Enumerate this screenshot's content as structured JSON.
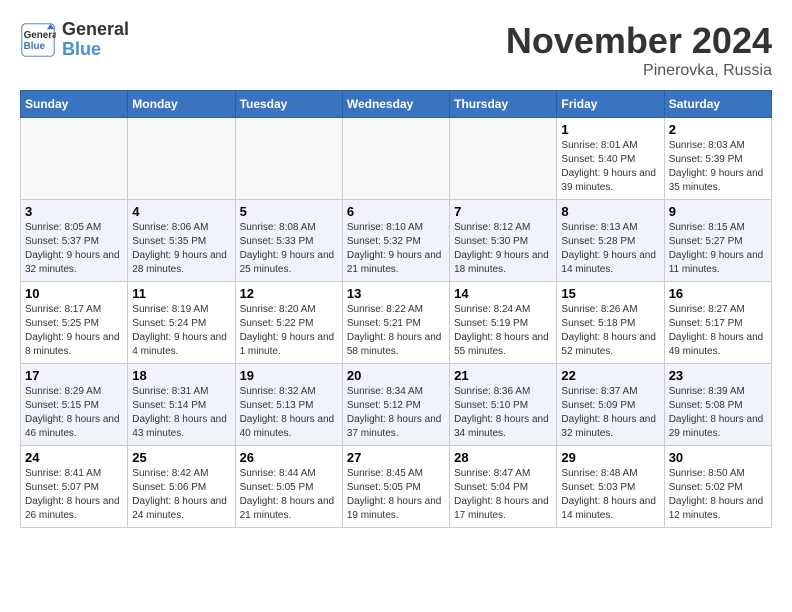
{
  "logo": {
    "line1": "General",
    "line2": "Blue"
  },
  "title": "November 2024",
  "location": "Pinerovka, Russia",
  "days_of_week": [
    "Sunday",
    "Monday",
    "Tuesday",
    "Wednesday",
    "Thursday",
    "Friday",
    "Saturday"
  ],
  "weeks": [
    [
      {
        "day": "",
        "info": ""
      },
      {
        "day": "",
        "info": ""
      },
      {
        "day": "",
        "info": ""
      },
      {
        "day": "",
        "info": ""
      },
      {
        "day": "",
        "info": ""
      },
      {
        "day": "1",
        "info": "Sunrise: 8:01 AM\nSunset: 5:40 PM\nDaylight: 9 hours and 39 minutes."
      },
      {
        "day": "2",
        "info": "Sunrise: 8:03 AM\nSunset: 5:39 PM\nDaylight: 9 hours and 35 minutes."
      }
    ],
    [
      {
        "day": "3",
        "info": "Sunrise: 8:05 AM\nSunset: 5:37 PM\nDaylight: 9 hours and 32 minutes."
      },
      {
        "day": "4",
        "info": "Sunrise: 8:06 AM\nSunset: 5:35 PM\nDaylight: 9 hours and 28 minutes."
      },
      {
        "day": "5",
        "info": "Sunrise: 8:08 AM\nSunset: 5:33 PM\nDaylight: 9 hours and 25 minutes."
      },
      {
        "day": "6",
        "info": "Sunrise: 8:10 AM\nSunset: 5:32 PM\nDaylight: 9 hours and 21 minutes."
      },
      {
        "day": "7",
        "info": "Sunrise: 8:12 AM\nSunset: 5:30 PM\nDaylight: 9 hours and 18 minutes."
      },
      {
        "day": "8",
        "info": "Sunrise: 8:13 AM\nSunset: 5:28 PM\nDaylight: 9 hours and 14 minutes."
      },
      {
        "day": "9",
        "info": "Sunrise: 8:15 AM\nSunset: 5:27 PM\nDaylight: 9 hours and 11 minutes."
      }
    ],
    [
      {
        "day": "10",
        "info": "Sunrise: 8:17 AM\nSunset: 5:25 PM\nDaylight: 9 hours and 8 minutes."
      },
      {
        "day": "11",
        "info": "Sunrise: 8:19 AM\nSunset: 5:24 PM\nDaylight: 9 hours and 4 minutes."
      },
      {
        "day": "12",
        "info": "Sunrise: 8:20 AM\nSunset: 5:22 PM\nDaylight: 9 hours and 1 minute."
      },
      {
        "day": "13",
        "info": "Sunrise: 8:22 AM\nSunset: 5:21 PM\nDaylight: 8 hours and 58 minutes."
      },
      {
        "day": "14",
        "info": "Sunrise: 8:24 AM\nSunset: 5:19 PM\nDaylight: 8 hours and 55 minutes."
      },
      {
        "day": "15",
        "info": "Sunrise: 8:26 AM\nSunset: 5:18 PM\nDaylight: 8 hours and 52 minutes."
      },
      {
        "day": "16",
        "info": "Sunrise: 8:27 AM\nSunset: 5:17 PM\nDaylight: 8 hours and 49 minutes."
      }
    ],
    [
      {
        "day": "17",
        "info": "Sunrise: 8:29 AM\nSunset: 5:15 PM\nDaylight: 8 hours and 46 minutes."
      },
      {
        "day": "18",
        "info": "Sunrise: 8:31 AM\nSunset: 5:14 PM\nDaylight: 8 hours and 43 minutes."
      },
      {
        "day": "19",
        "info": "Sunrise: 8:32 AM\nSunset: 5:13 PM\nDaylight: 8 hours and 40 minutes."
      },
      {
        "day": "20",
        "info": "Sunrise: 8:34 AM\nSunset: 5:12 PM\nDaylight: 8 hours and 37 minutes."
      },
      {
        "day": "21",
        "info": "Sunrise: 8:36 AM\nSunset: 5:10 PM\nDaylight: 8 hours and 34 minutes."
      },
      {
        "day": "22",
        "info": "Sunrise: 8:37 AM\nSunset: 5:09 PM\nDaylight: 8 hours and 32 minutes."
      },
      {
        "day": "23",
        "info": "Sunrise: 8:39 AM\nSunset: 5:08 PM\nDaylight: 8 hours and 29 minutes."
      }
    ],
    [
      {
        "day": "24",
        "info": "Sunrise: 8:41 AM\nSunset: 5:07 PM\nDaylight: 8 hours and 26 minutes."
      },
      {
        "day": "25",
        "info": "Sunrise: 8:42 AM\nSunset: 5:06 PM\nDaylight: 8 hours and 24 minutes."
      },
      {
        "day": "26",
        "info": "Sunrise: 8:44 AM\nSunset: 5:05 PM\nDaylight: 8 hours and 21 minutes."
      },
      {
        "day": "27",
        "info": "Sunrise: 8:45 AM\nSunset: 5:05 PM\nDaylight: 8 hours and 19 minutes."
      },
      {
        "day": "28",
        "info": "Sunrise: 8:47 AM\nSunset: 5:04 PM\nDaylight: 8 hours and 17 minutes."
      },
      {
        "day": "29",
        "info": "Sunrise: 8:48 AM\nSunset: 5:03 PM\nDaylight: 8 hours and 14 minutes."
      },
      {
        "day": "30",
        "info": "Sunrise: 8:50 AM\nSunset: 5:02 PM\nDaylight: 8 hours and 12 minutes."
      }
    ]
  ]
}
